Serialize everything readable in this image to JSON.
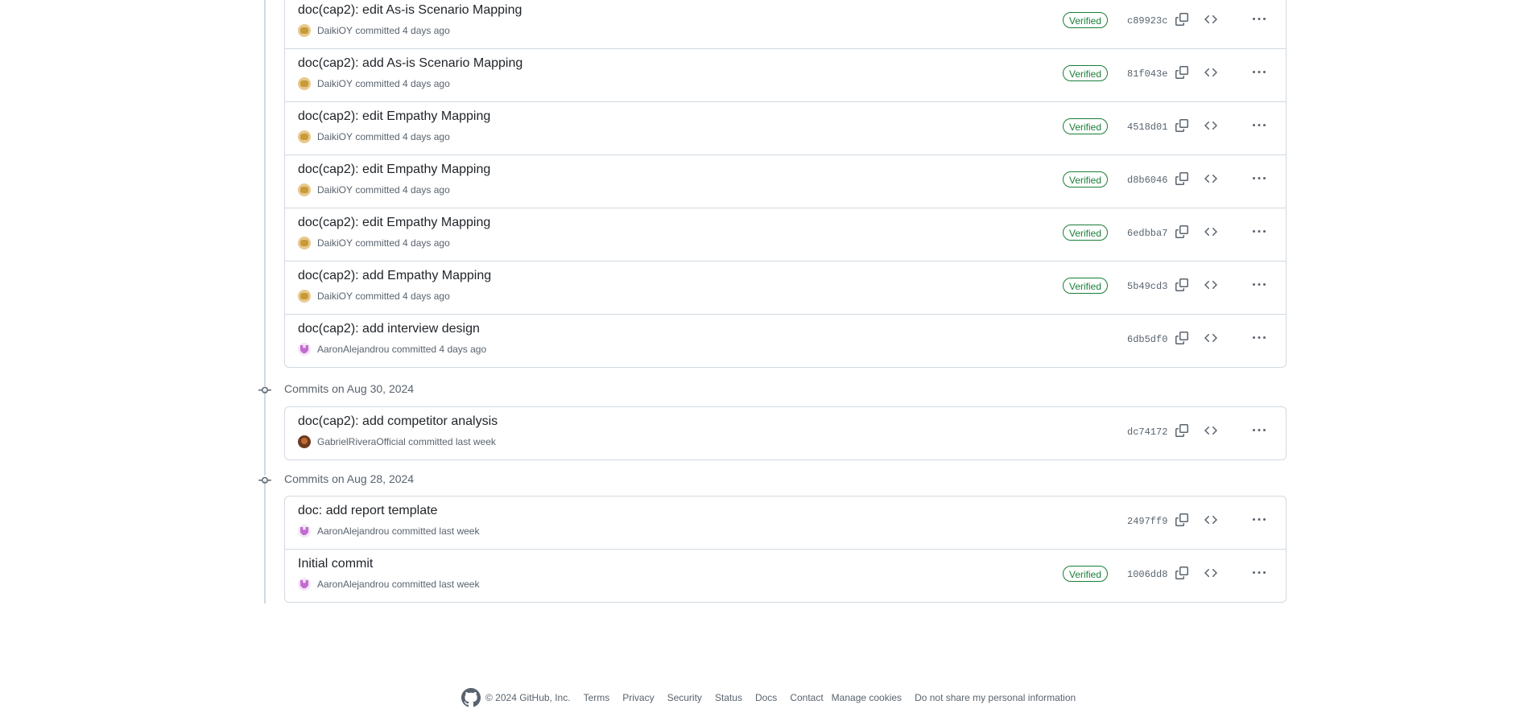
{
  "groups": [
    {
      "header": "",
      "commits": [
        {
          "title": "doc(cap2): edit As-is Scenario Mapping",
          "author": "DaikiOY",
          "when": "committed 4 days ago",
          "verified": "Verified",
          "sha": "c89923c",
          "avatar": "daiki"
        },
        {
          "title": "doc(cap2): add As-is Scenario Mapping",
          "author": "DaikiOY",
          "when": "committed 4 days ago",
          "verified": "Verified",
          "sha": "81f043e",
          "avatar": "daiki"
        },
        {
          "title": "doc(cap2): edit Empathy Mapping",
          "author": "DaikiOY",
          "when": "committed 4 days ago",
          "verified": "Verified",
          "sha": "4518d01",
          "avatar": "daiki"
        },
        {
          "title": "doc(cap2): edit Empathy Mapping",
          "author": "DaikiOY",
          "when": "committed 4 days ago",
          "verified": "Verified",
          "sha": "d8b6046",
          "avatar": "daiki"
        },
        {
          "title": "doc(cap2): edit Empathy Mapping",
          "author": "DaikiOY",
          "when": "committed 4 days ago",
          "verified": "Verified",
          "sha": "6edbba7",
          "avatar": "daiki"
        },
        {
          "title": "doc(cap2): add Empathy Mapping",
          "author": "DaikiOY",
          "when": "committed 4 days ago",
          "verified": "Verified",
          "sha": "5b49cd3",
          "avatar": "daiki"
        },
        {
          "title": "doc(cap2): add interview design",
          "author": "AaronAlejandrou",
          "when": "committed 4 days ago",
          "verified": "",
          "sha": "6db5df0",
          "avatar": "aaron"
        }
      ]
    },
    {
      "header": "Commits on Aug 30, 2024",
      "commits": [
        {
          "title": "doc(cap2): add competitor analysis",
          "author": "GabrielRiveraOfficial",
          "when": "committed last week",
          "verified": "",
          "sha": "dc74172",
          "avatar": "gabriel"
        }
      ]
    },
    {
      "header": "Commits on Aug 28, 2024",
      "commits": [
        {
          "title": "doc: add report template",
          "author": "AaronAlejandrou",
          "when": "committed last week",
          "verified": "",
          "sha": "2497ff9",
          "avatar": "aaron"
        },
        {
          "title": "Initial commit",
          "author": "AaronAlejandrou",
          "when": "committed last week",
          "verified": "Verified",
          "sha": "1006dd8",
          "avatar": "aaron"
        }
      ]
    }
  ],
  "footer": {
    "copyright": "© 2024 GitHub, Inc.",
    "links": [
      "Terms",
      "Privacy",
      "Security",
      "Status",
      "Docs",
      "Contact",
      "Manage cookies",
      "Do not share my personal information"
    ]
  },
  "icons": {
    "copy": "copy-icon",
    "browse": "code-icon",
    "more": "kebab-horizontal-icon",
    "commit": "git-commit-icon",
    "logo": "github-mark-icon"
  },
  "colors": {
    "verified": "#1a7f37",
    "muted": "#59636e",
    "border": "#d1d9e0"
  }
}
